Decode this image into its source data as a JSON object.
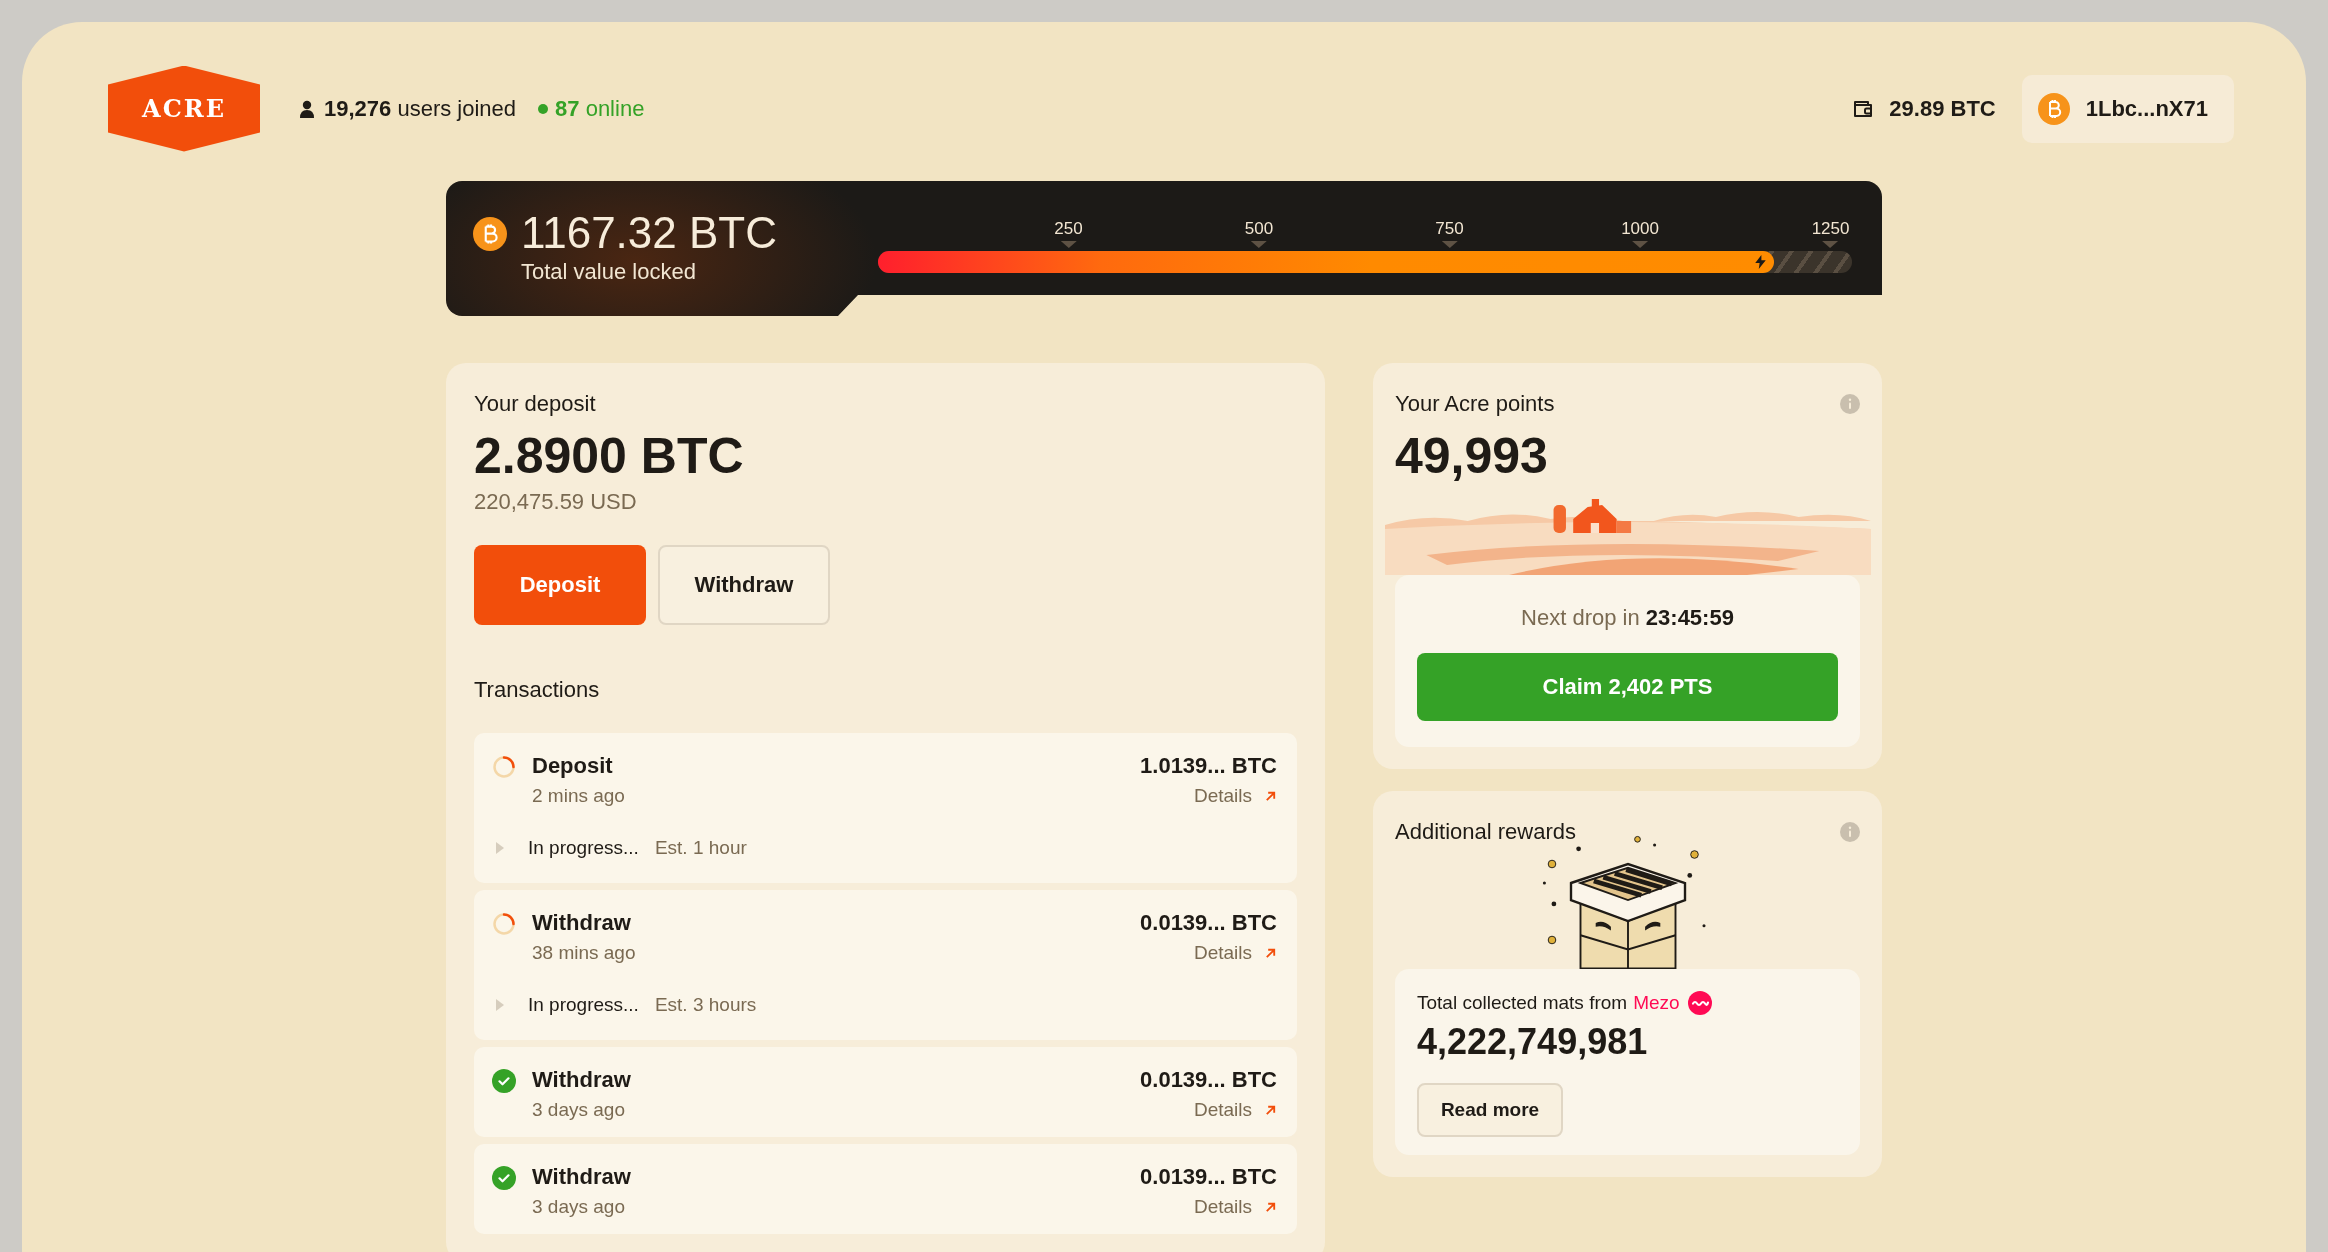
{
  "header": {
    "logo": "ACRE",
    "users_count": "19,276",
    "users_label": "users joined",
    "online_count": "87",
    "online_label": "online",
    "wallet_balance": "29.89 BTC",
    "account": "1Lbc...nX71"
  },
  "tvl": {
    "amount": "1167.32 BTC",
    "label": "Total value locked",
    "ticks": [
      "250",
      "500",
      "750",
      "1000",
      "1250"
    ],
    "level": 0.92
  },
  "deposit": {
    "title": "Your deposit",
    "amount": "2.8900 BTC",
    "usd": "220,475.59 USD",
    "buttons": [
      {
        "label": "Deposit",
        "kind": "primary"
      },
      {
        "label": "Withdraw",
        "kind": "secondary"
      }
    ]
  },
  "transactions": {
    "title": "Transactions",
    "items": [
      {
        "type": "Deposit",
        "time": "2 mins ago",
        "amount": "1.0139... BTC",
        "link": "Details",
        "in_progress": true,
        "progress": "In progress...",
        "estimate": "Est. 1 hour"
      },
      {
        "type": "Withdraw",
        "time": "38 mins ago",
        "amount": "0.0139... BTC",
        "link": "Details",
        "in_progress": true,
        "progress": "In progress...",
        "estimate": "Est. 3 hours"
      },
      {
        "type": "Withdraw",
        "time": "3 days ago",
        "amount": "0.0139... BTC",
        "link": "Details",
        "in_progress": false
      },
      {
        "type": "Withdraw",
        "time": "3 days ago",
        "amount": "0.0139... BTC",
        "link": "Details",
        "in_progress": false
      }
    ]
  },
  "points": {
    "title": "Your Acre points",
    "amount": "49,993",
    "next_drop_label": "Next drop in",
    "next_drop_time": "23:45:59",
    "claim_button": "Claim 2,402 PTS"
  },
  "rewards": {
    "title": "Additional rewards",
    "collected_label": "Total collected mats from",
    "source": "Mezo",
    "amount": "4,222,749,981",
    "read_more_button": "Read more"
  }
}
